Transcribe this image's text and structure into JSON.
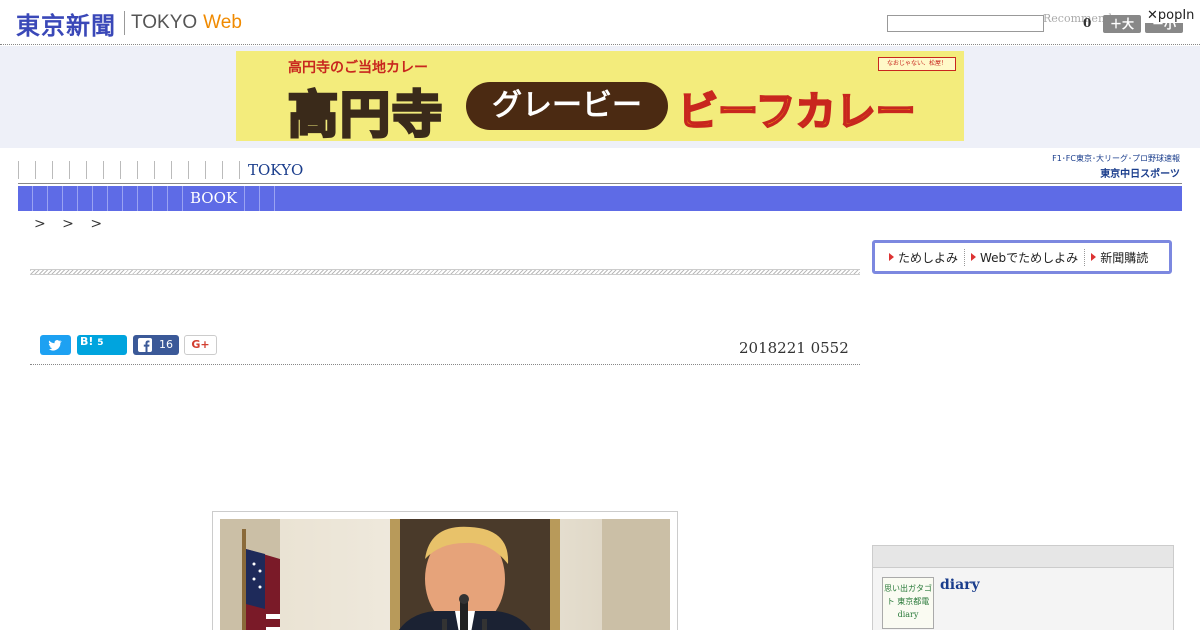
{
  "header": {
    "logo_jp": "東京新聞",
    "logo_tokyo": "TOKYO",
    "logo_web": "Web",
    "recommend_text": "Recommend",
    "count": "0",
    "font_large_label": "＋大",
    "font_small_label": "－小",
    "popin_label": "✕popIn"
  },
  "ad": {
    "top_text": "高円寺のご当地カレー",
    "main_text": "高円寺",
    "gravy_text": "グレービー",
    "beef_text": "ビーフカレー",
    "badge_text": "なおじゃない、松屋！"
  },
  "nav": {
    "items": [
      "",
      "",
      "",
      "",
      "",
      "",
      "",
      "",
      "",
      "",
      "",
      "",
      "",
      "TOKYO"
    ],
    "sub_items": [
      "",
      "",
      "",
      "",
      "",
      "",
      "",
      "",
      "",
      "",
      "",
      "BOOK",
      "",
      ""
    ],
    "chunichi_line1": "F1･FC東京･大リーグ･プロ野球速報",
    "chunichi_line2": "東京中日スポーツ"
  },
  "breadcrumb": "> > >",
  "share": {
    "hatena_label": "B!",
    "hatena_count": "5",
    "facebook_count": "16",
    "gplus_label": "G+"
  },
  "article": {
    "date": "2018221 0552"
  },
  "sidebar": {
    "tameshi_items": [
      "ためしよみ",
      "Webでためしよみ",
      "新聞購読"
    ],
    "diary_title": "diary",
    "diary_thumb_text": "思い出ガタゴト 東京都電 diary"
  },
  "colors": {
    "brand_blue": "#3a48b8",
    "subnav_blue": "#5e6be6",
    "web_orange": "#f08a00"
  }
}
